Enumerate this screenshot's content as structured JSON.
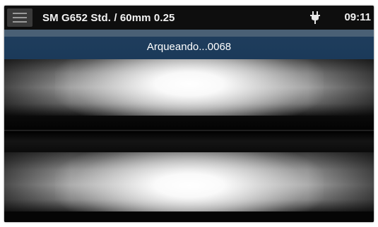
{
  "header": {
    "title": "SM G652 Std. / 60mm 0.25",
    "menu_icon": "hamburger-menu-icon",
    "power_icon": "ac-power-plug-icon",
    "time": "09:11"
  },
  "status": {
    "message": "Arqueando...0068"
  },
  "colors": {
    "top_bar": "#0e0e0e",
    "menu_button": "#3a3a3a",
    "status_banner": "#1f3d5c",
    "status_banner_stripe": "#4a6075",
    "text": "#ffffff"
  }
}
